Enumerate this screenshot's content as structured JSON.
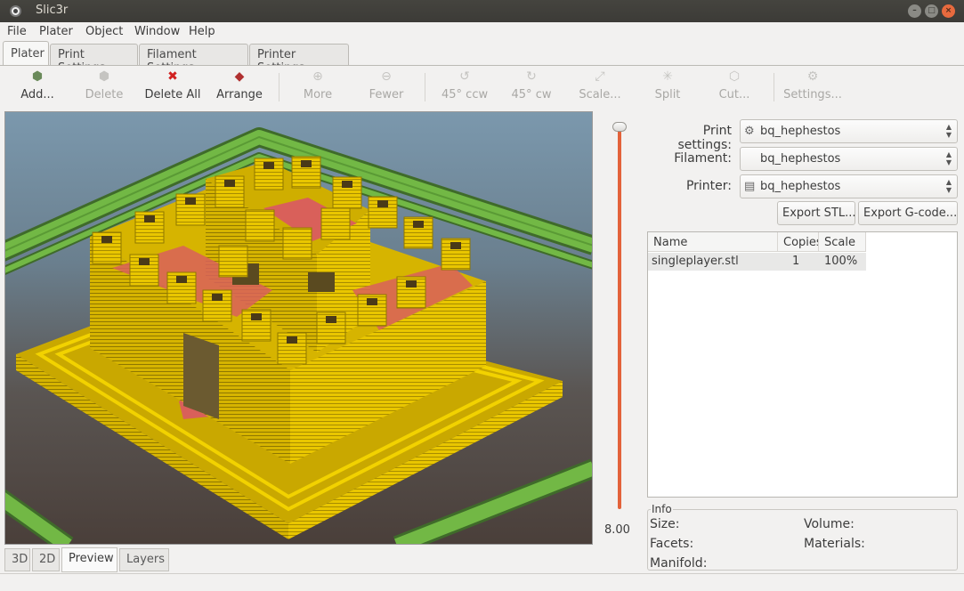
{
  "window": {
    "title": "Slic3r"
  },
  "menu": [
    "File",
    "Plater",
    "Object",
    "Window",
    "Help"
  ],
  "tabs": [
    "Plater",
    "Print Settings",
    "Filament Settings",
    "Printer Settings"
  ],
  "toolbar": {
    "add": "Add...",
    "delete": "Delete",
    "delete_all": "Delete All",
    "arrange": "Arrange",
    "more": "More",
    "fewer": "Fewer",
    "rotate_ccw": "45° ccw",
    "rotate_cw": "45° cw",
    "scale": "Scale...",
    "split": "Split",
    "cut": "Cut...",
    "settings": "Settings..."
  },
  "layer_slider": {
    "value": "8.00"
  },
  "view_tabs": [
    "3D",
    "2D",
    "Preview",
    "Layers"
  ],
  "right_panel": {
    "print_settings_label": "Print settings:",
    "print_settings_value": "bq_hephestos",
    "filament_label": "Filament:",
    "filament_value": "bq_hephestos",
    "printer_label": "Printer:",
    "printer_value": "bq_hephestos",
    "export_stl": "Export STL...",
    "export_gcode": "Export G-code..."
  },
  "object_list": {
    "columns": [
      "Name",
      "Copies",
      "Scale"
    ],
    "rows": [
      {
        "name": "singleplayer.stl",
        "copies": "1",
        "scale": "100%"
      }
    ]
  },
  "info": {
    "legend": "Info",
    "size": "Size:",
    "volume": "Volume:",
    "facets": "Facets:",
    "materials": "Materials:",
    "manifold": "Manifold:"
  },
  "colors": {
    "skirt": "#6db33f",
    "perimeter": "#e8c800",
    "infill": "#d9605a",
    "slider": "#e3623a"
  }
}
